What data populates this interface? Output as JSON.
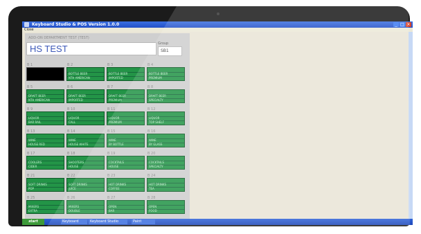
{
  "window": {
    "title": "Keyboard Studio & POS Version 1.0.0",
    "min": "_",
    "max": "□",
    "close": "×"
  },
  "menu": [
    "Close"
  ],
  "panel": {
    "header_label": "ADD-ON DEPARTMENT TEST (TEST)",
    "test_name": "HS TEST",
    "group_label": "Group",
    "group_value": "SB1"
  },
  "grid": [
    [
      {
        "label": "B 1",
        "line1": "",
        "line2": "",
        "black": true
      },
      {
        "label": "B 2",
        "line1": "BOTTLE BEER",
        "line2": "NTH AMERICAN"
      },
      {
        "label": "B 3",
        "line1": "BOTTLE BEER",
        "line2": "IMPORTED"
      },
      {
        "label": "B 4",
        "line1": "BOTTLE BEER",
        "line2": "PREMIUM"
      }
    ],
    [
      {
        "label": "B 5",
        "line1": "DRAFT BEER",
        "line2": "NTH AMERICAN"
      },
      {
        "label": "B 6",
        "line1": "DRAFT BEER",
        "line2": "IMPORTED"
      },
      {
        "label": "B 7",
        "line1": "DRAFT BEER",
        "line2": "PREMIUM"
      },
      {
        "label": "B 8",
        "line1": "DRAFT BEER",
        "line2": "SPECIALTY"
      }
    ],
    [
      {
        "label": "B 9",
        "line1": "LIQUOR",
        "line2": "BAR RAIL"
      },
      {
        "label": "B 10",
        "line1": "LIQUOR",
        "line2": "CALL"
      },
      {
        "label": "B 11",
        "line1": "LIQUOR",
        "line2": "PREMIUM"
      },
      {
        "label": "B 12",
        "line1": "LIQUOR",
        "line2": "TOP SHELF"
      }
    ],
    [
      {
        "label": "B 13",
        "line1": "WINE",
        "line2": "HOUSE RED"
      },
      {
        "label": "B 14",
        "line1": "WINE",
        "line2": "HOUSE WHITE"
      },
      {
        "label": "B 15",
        "line1": "WINE",
        "line2": "BY BOTTLE"
      },
      {
        "label": "B 16",
        "line1": "WINE",
        "line2": "BY GLASS"
      }
    ],
    [
      {
        "label": "B 17",
        "line1": "COOLERS",
        "line2": "CIDER"
      },
      {
        "label": "B 18",
        "line1": "SHOOTERS",
        "line2": "HOUSE"
      },
      {
        "label": "B 19",
        "line1": "COCKTAILS",
        "line2": "HOUSE"
      },
      {
        "label": "B 20",
        "line1": "COCKTAILS",
        "line2": "SPECIALTY"
      }
    ],
    [
      {
        "label": "B 21",
        "line1": "SOFT DRINKS",
        "line2": "POP"
      },
      {
        "label": "B 22",
        "line1": "SOFT DRINKS",
        "line2": "JUICE"
      },
      {
        "label": "B 23",
        "line1": "HOT DRINKS",
        "line2": "COFFEE"
      },
      {
        "label": "B 24",
        "line1": "HOT DRINKS",
        "line2": "TEA"
      }
    ],
    [
      {
        "label": "B 25",
        "line1": "MIXERS",
        "line2": "EXTRA"
      },
      {
        "label": "B 26",
        "line1": "MIXERS",
        "line2": "DOUBLE"
      },
      {
        "label": "B 27",
        "line1": "OPEN",
        "line2": "BAR"
      },
      {
        "label": "B 28",
        "line1": "OPEN",
        "line2": "FOOD"
      }
    ]
  ],
  "taskbar": {
    "start": "start",
    "items": [
      "Keyboard",
      "Keyboard Studio",
      "Paint"
    ]
  }
}
